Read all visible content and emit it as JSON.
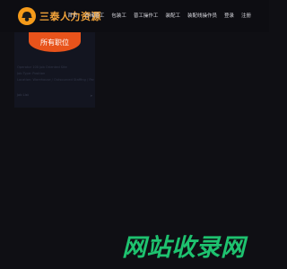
{
  "brand": {
    "name": "三泰人力资源",
    "accent": "#f2a33a",
    "logo_icon": "worker-helmet-icon"
  },
  "nav": {
    "items": [
      "首页",
      "仓储普工",
      "包装工",
      "普工操作工",
      "装配工",
      "装配线操作员",
      "登录",
      "注册"
    ]
  },
  "category_tab": {
    "label": "所有职位",
    "color": "#e8531b"
  },
  "info_panel": {
    "lines": [
      "Operator 100 Job Oriented Site",
      "Job Type: Position",
      "Location: Warehouse / Outsourced Staffing / Part-time Picker"
    ],
    "footer_left": "Job List",
    "footer_right": "»"
  },
  "watermark": {
    "text": "网站收录网",
    "color": "#1ec26f"
  }
}
